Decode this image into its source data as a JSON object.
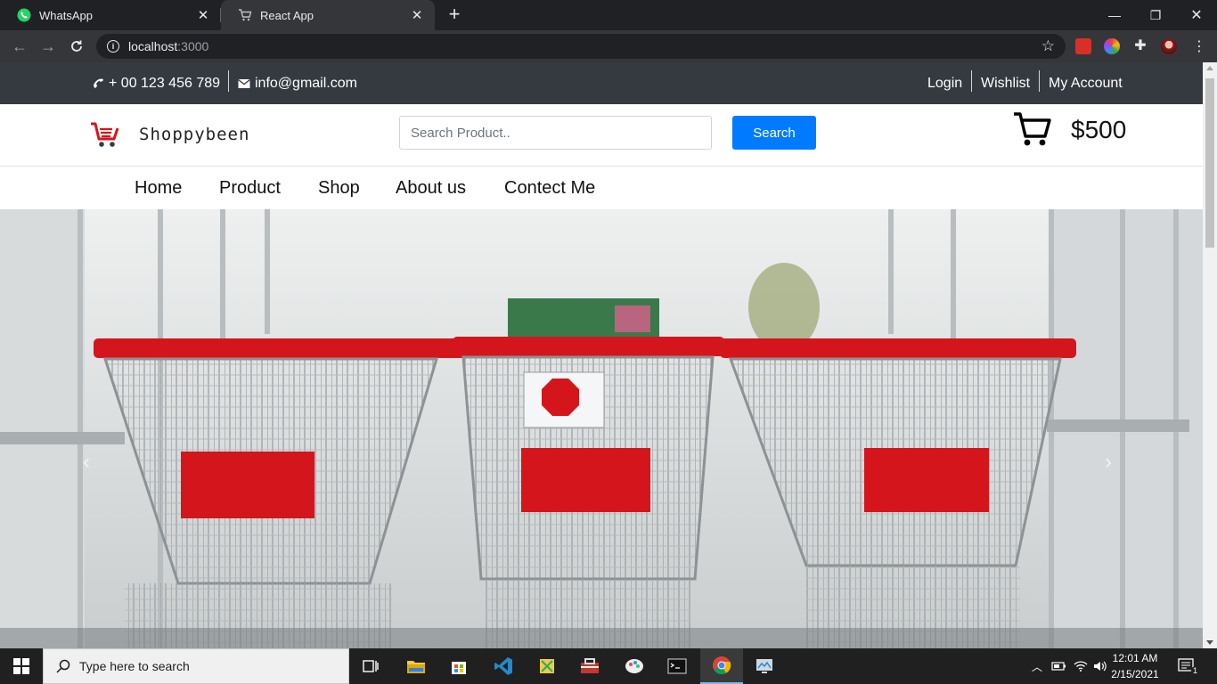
{
  "browser": {
    "tabs": [
      {
        "title": "WhatsApp",
        "icon": "whatsapp-icon",
        "active": false
      },
      {
        "title": "React App",
        "icon": "cart-favicon-icon",
        "active": true
      }
    ],
    "url_host": "localhost",
    "url_port": ":3000"
  },
  "topbar": {
    "phone": "+ 00 123 456 789",
    "email": "info@gmail.com",
    "links": [
      "Login",
      "Wishlist",
      "My Account"
    ]
  },
  "header": {
    "brand": "Shoppybeen",
    "search_placeholder": "Search Product..",
    "search_button": "Search",
    "cart_total": "$500"
  },
  "nav": {
    "items": [
      "Home",
      "Product",
      "Shop",
      "About us",
      "Contect Me"
    ]
  },
  "hero": {
    "image": "shopping-carts-photo",
    "prev": "‹",
    "next": "›"
  },
  "taskbar": {
    "search_placeholder": "Type here to search",
    "time": "12:01 AM",
    "date": "2/15/2021",
    "notification_count": "1"
  },
  "colors": {
    "topbar_bg": "#343a40",
    "primary": "#007bff",
    "cart_red": "#d4161c"
  }
}
